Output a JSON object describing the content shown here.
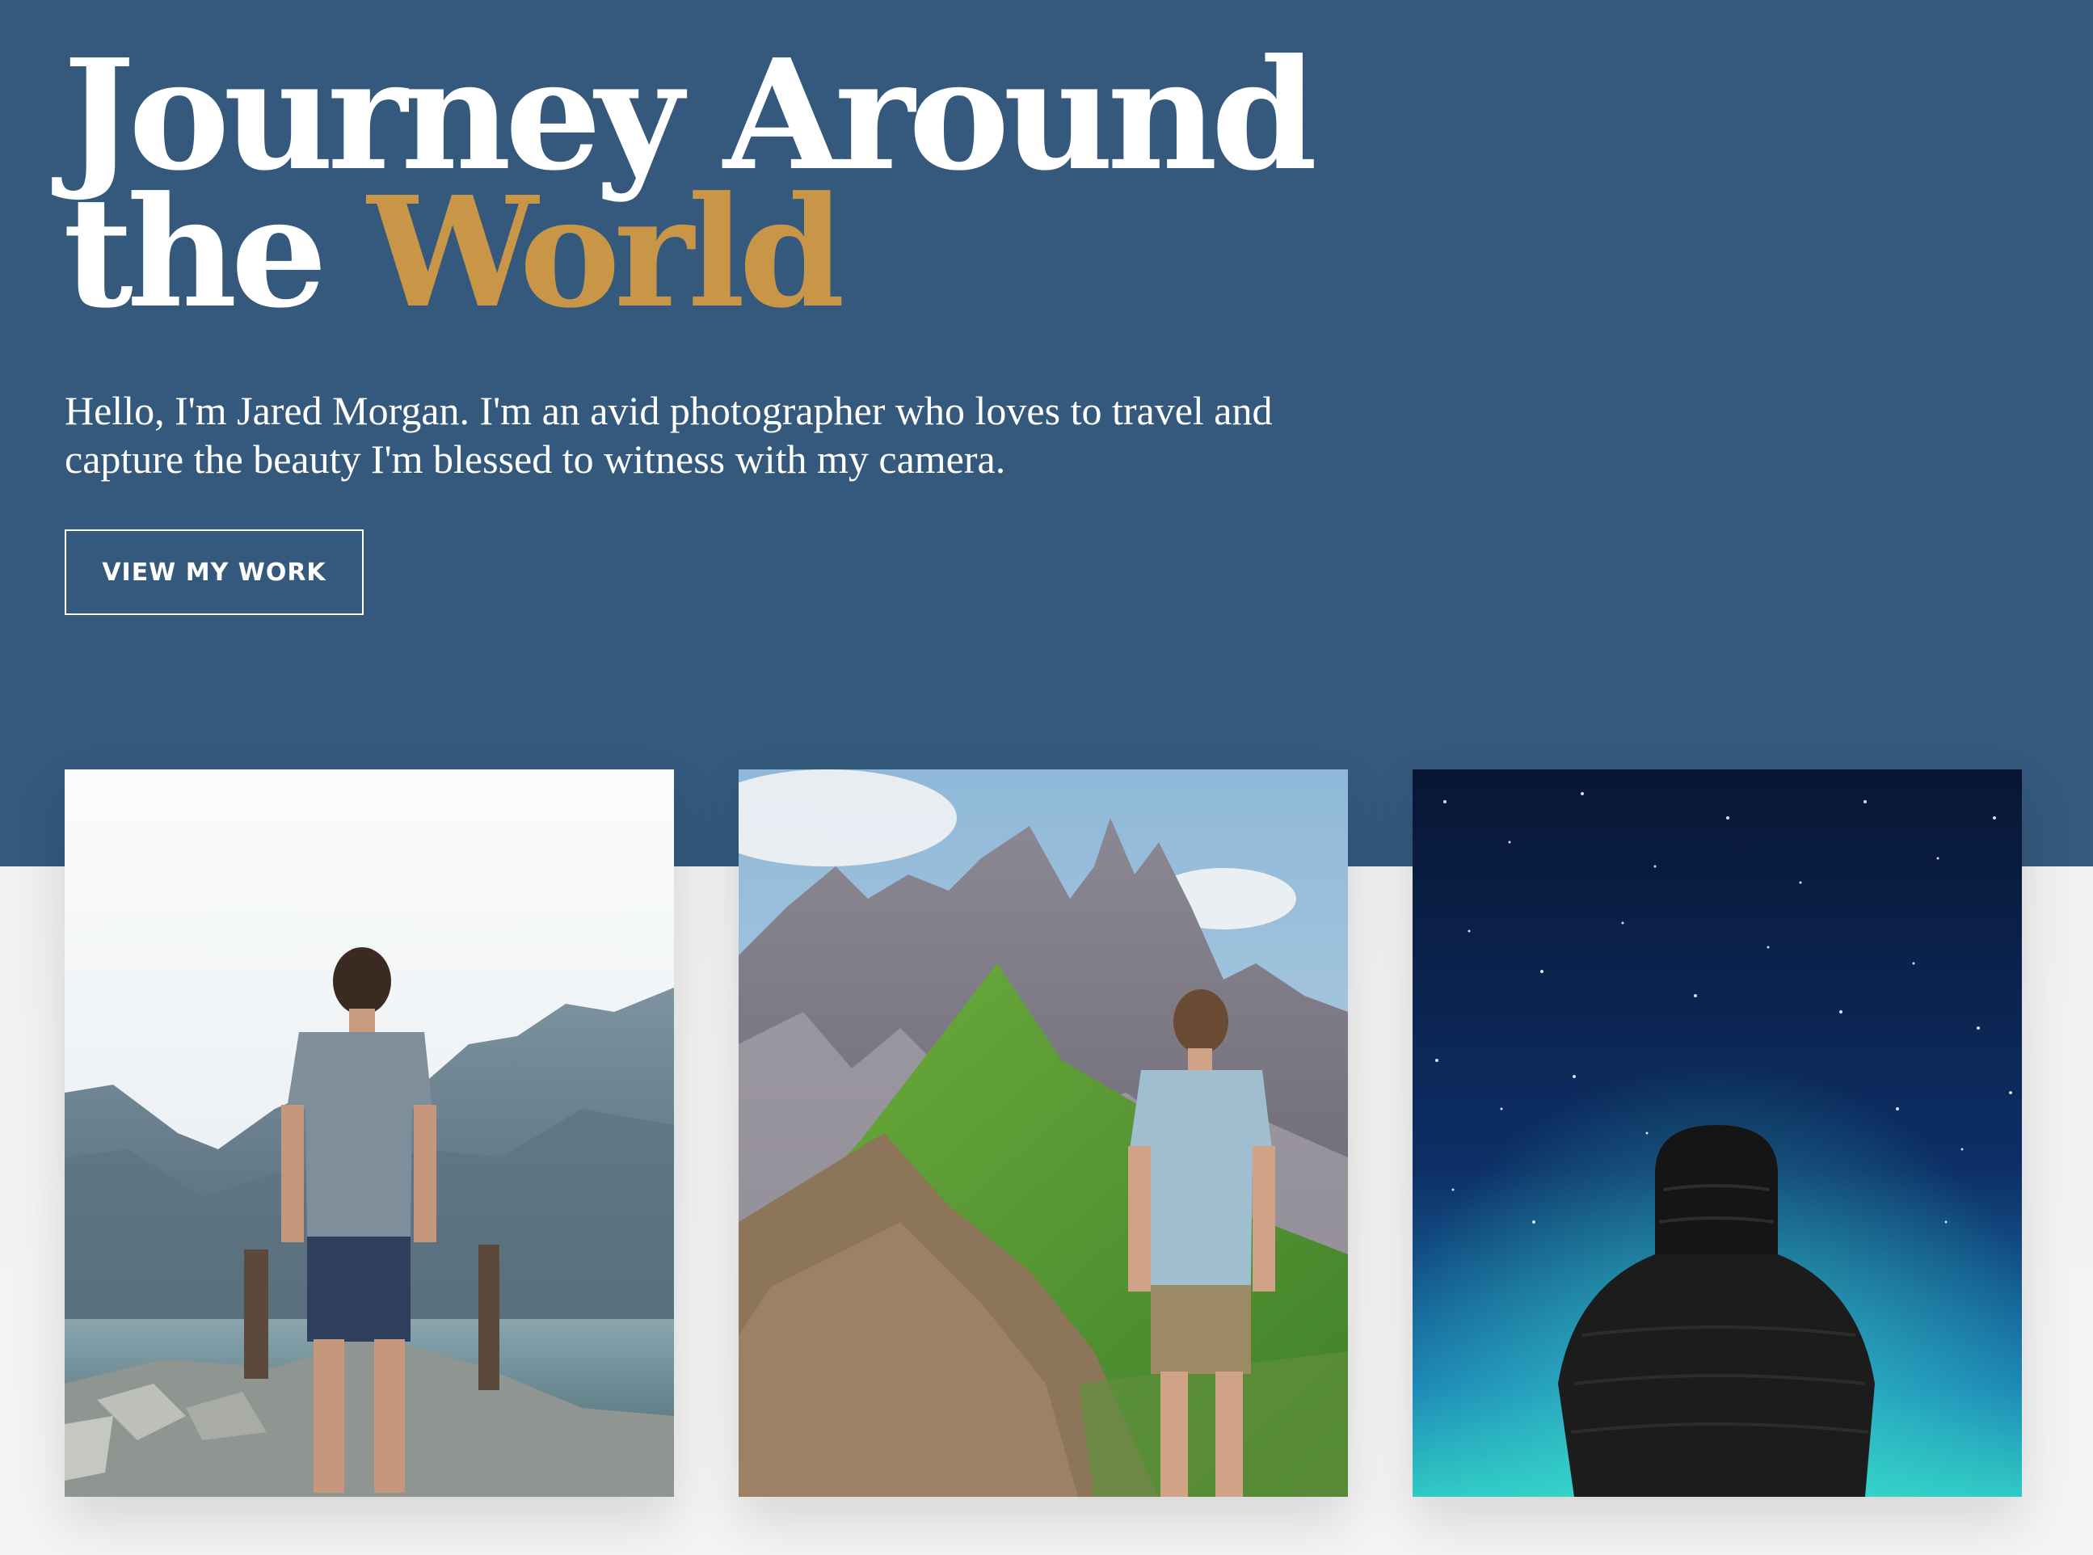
{
  "hero": {
    "title_line1": "Journey Around",
    "title_line2_prefix": "the ",
    "title_line2_accent": "World",
    "intro": "Hello, I'm Jared Morgan. I'm an avid photographer who loves to travel and capture the beauty I'm blessed to witness with my camera.",
    "cta_label": "VIEW MY WORK"
  },
  "colors": {
    "hero_background": "#34597d",
    "accent": "#c99547",
    "lower_background": "#f3f3f3",
    "text_light": "#ffffff"
  },
  "gallery": {
    "items": [
      {
        "subject": "man-on-lake-pier-photo"
      },
      {
        "subject": "man-before-mountain-peaks-photo"
      },
      {
        "subject": "hooded-person-under-starry-sky-photo"
      }
    ]
  }
}
